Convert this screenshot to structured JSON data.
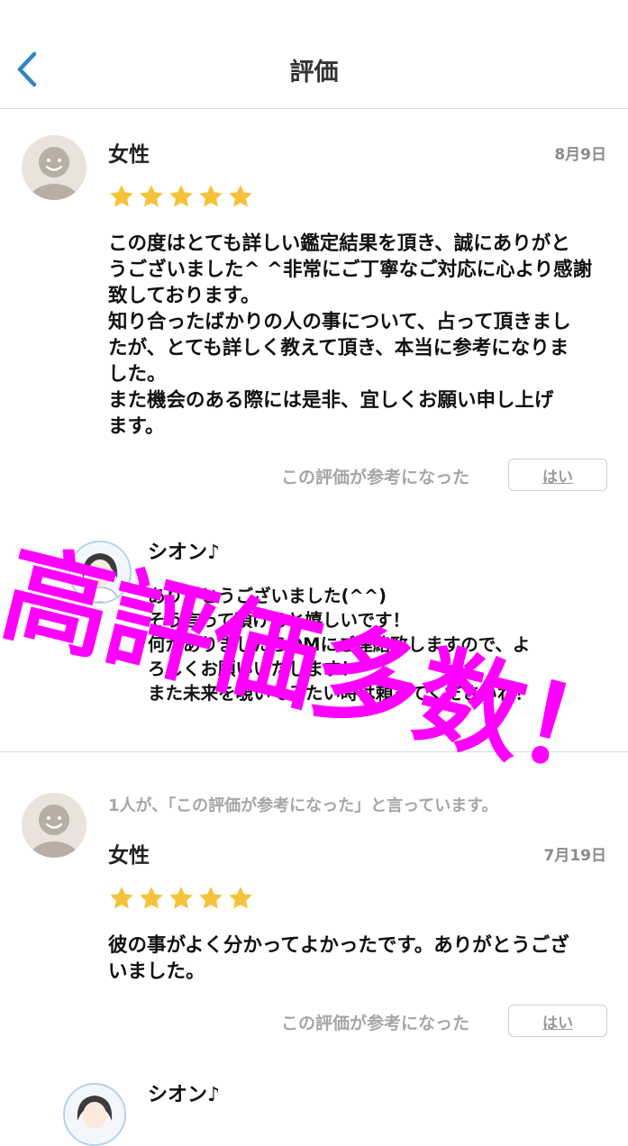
{
  "header": {
    "title": "評価",
    "back_icon": "chevron-left-icon"
  },
  "reviews": [
    {
      "name": "女性",
      "date": "8月9日",
      "rating": 5,
      "text": "この度はとても詳しい鑑定結果を頂き、誠にありがと\nうございました^ ^非常にご丁寧なご対応に心より感謝\n致しております。\n知り合ったばかりの人の事について、占って頂きまし\nたが、とても詳しく教えて頂き、本当に参考になりま\nした。\nまた機会のある際には是非、宜しくお願い申し上げ\nます。",
      "helpful_label": "この評価が参考になった",
      "yes_label": "はい",
      "reply": {
        "name": "シオン♪",
        "text": "ありがとうございました(^^)\nそう言って頂けると嬉しいです！\n何かありましたらDMにご連絡致しますので、よ\nろしくお願いいたします！\nまた未来を覗いてみたい時は頼ってくださいね！"
      }
    },
    {
      "helpful_count_text": "1人が、「この評価が参考になった」と言っています。",
      "name": "女性",
      "date": "7月19日",
      "rating": 5,
      "text": "彼の事がよく分かってよかったです。ありがとうござ\nいました。",
      "helpful_label": "この評価が参考になった",
      "yes_label": "はい",
      "reply": {
        "name": "シオン♪"
      }
    }
  ],
  "overlay": {
    "text": "高評価多数！",
    "color": "#ff00ff"
  },
  "colors": {
    "star": "#f5c33b",
    "accent": "#2f86c4",
    "overlay": "#ff00ff"
  }
}
